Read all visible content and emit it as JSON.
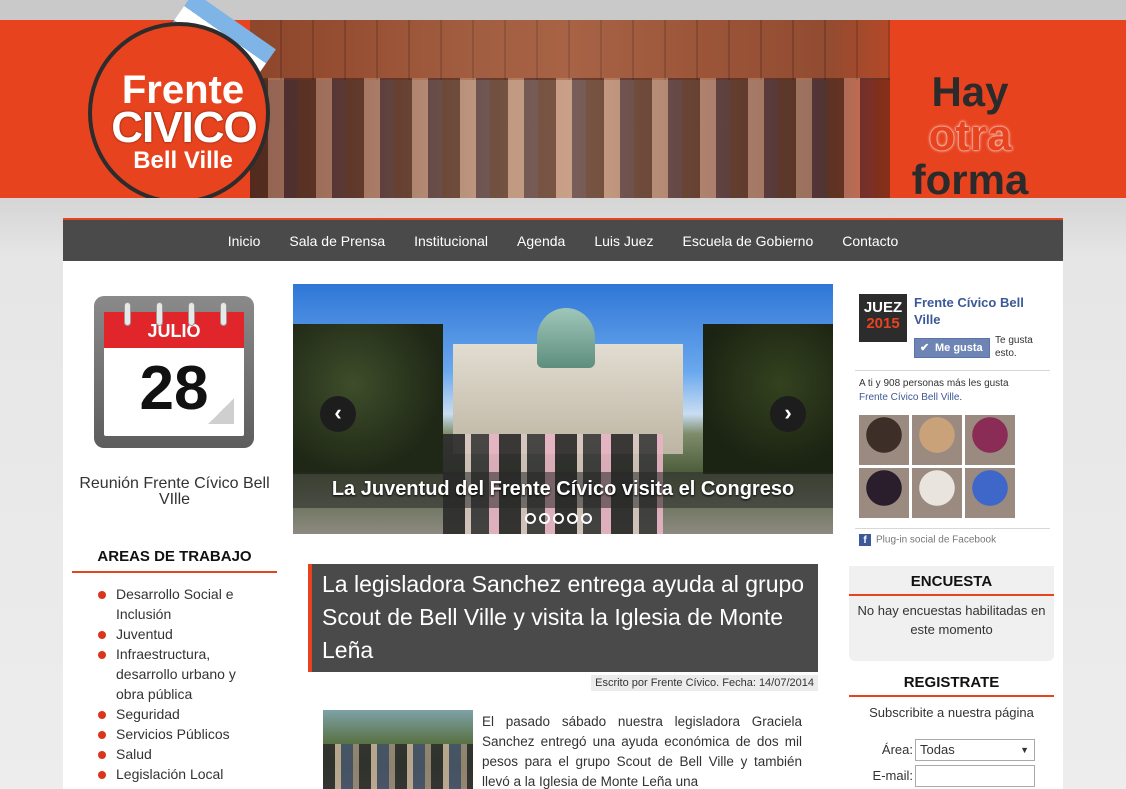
{
  "colors": {
    "accent": "#e8431f",
    "nav_bg": "#4a4a4a",
    "facebook_blue": "#3b5998",
    "calendar_red": "#e1262b"
  },
  "header": {
    "logo_line1": "Frente",
    "logo_line2": "CIVICO",
    "logo_line3": "Bell Ville",
    "slogan_line1": "Hay",
    "slogan_line2": "otra",
    "slogan_line3": "forma"
  },
  "nav": {
    "items": [
      {
        "label": "Inicio"
      },
      {
        "label": "Sala de Prensa"
      },
      {
        "label": "Institucional"
      },
      {
        "label": "Agenda"
      },
      {
        "label": "Luis Juez"
      },
      {
        "label": "Escuela de Gobierno"
      },
      {
        "label": "Contacto"
      }
    ]
  },
  "calendar": {
    "month": "JULIO",
    "day": "28",
    "event": "Reunión Frente Cívico Bell VIlle"
  },
  "areas": {
    "title": "AREAS DE TRABAJO",
    "items": [
      "Desarrollo Social e Inclusión",
      "Juventud",
      "Infraestructura, desarrollo urbano y obra pública",
      "Seguridad",
      "Servicios Públicos",
      "Salud",
      "Legislación Local"
    ]
  },
  "slider": {
    "caption": "La Juventud del Frente Cívico visita el Congreso",
    "prev_icon": "chevron-left-icon",
    "next_icon": "chevron-right-icon",
    "prev_glyph": "‹",
    "next_glyph": "›",
    "dot_count": 5,
    "active_dot": 5
  },
  "article": {
    "title": "La legisladora Sanchez entrega ayuda al grupo Scout de Bell Ville y visita la Iglesia de Monte Leña",
    "meta": "Escrito por Frente Cívico. Fecha: 14/07/2014",
    "body": "El pasado sábado nuestra legisladora Graciela Sanchez entregó una ayuda económica de dos mil pesos para el grupo Scout de Bell Ville y también llevó a la Iglesia de Monte Leña una"
  },
  "facebook": {
    "logo_line1": "JUEZ",
    "logo_line2": "2015",
    "page_name": "Frente Cívico Bell Ville",
    "like_button": "Me gusta",
    "likes_this": "Te gusta esto.",
    "count_text": "A ti y 908 personas más les gusta",
    "count_link": "Frente Cívico Bell Ville",
    "count_period": ".",
    "plugin_text": "Plug-in social de Facebook",
    "fb_glyph": "f",
    "face_colors": [
      "#3d2e28",
      "#c9a27a",
      "#8a2c55",
      "#2a1d2c",
      "#e9e4de",
      "#3f66c9"
    ]
  },
  "poll": {
    "title": "ENCUESTA",
    "message": "No hay encuestas habilitadas en este momento"
  },
  "register": {
    "title": "REGISTRATE",
    "subtitle": "Subscribite a nuestra página",
    "area_label": "Área:",
    "area_value": "Todas",
    "email_label": "E-mail:"
  }
}
